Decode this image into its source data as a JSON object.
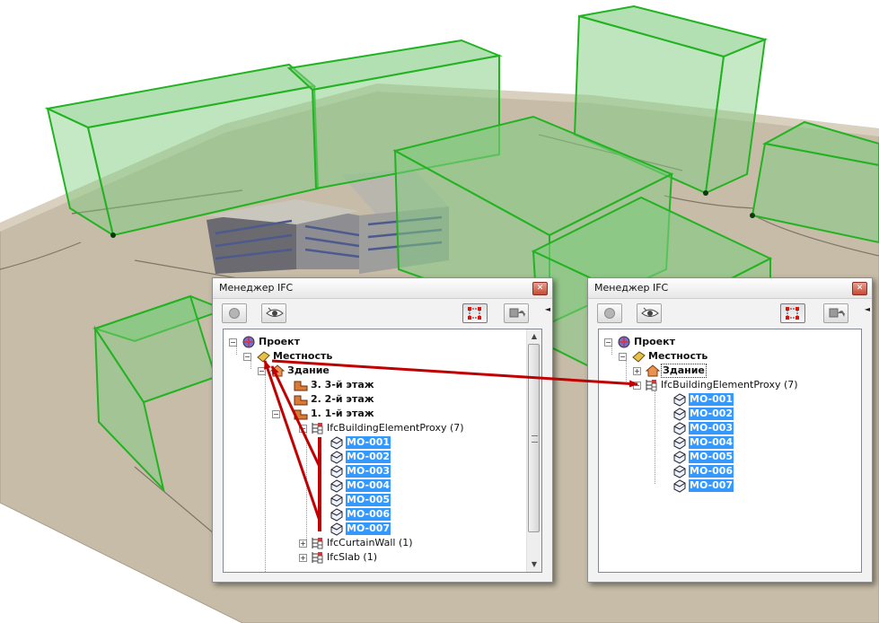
{
  "colors": {
    "bbox_fill": "#7fcc7f",
    "bbox_edge": "#22b322",
    "ground": "#c7bca8",
    "annotation_arrow": "#c00000",
    "selection": "#3399ff"
  },
  "left_window": {
    "title": "Менеджер IFC",
    "tree": {
      "project": "Проект",
      "site": "Местность",
      "building": "Здание",
      "storeys": [
        "3. 3-й этаж",
        "2. 2-й этаж",
        "1. 1-й этаж"
      ],
      "proxy_group": "IfcBuildingElementProxy (7)",
      "proxy_items": [
        "MO-001",
        "MO-002",
        "MO-003",
        "MO-004",
        "MO-005",
        "MO-006",
        "MO-007"
      ],
      "curtain_wall_group": "IfcCurtainWall (1)",
      "slab_group": "IfcSlab (1)"
    }
  },
  "right_window": {
    "title": "Менеджер IFC",
    "tree": {
      "project": "Проект",
      "site": "Местность",
      "building": "Здание",
      "proxy_group": "IfcBuildingElementProxy (7)",
      "proxy_items": [
        "MO-001",
        "MO-002",
        "MO-003",
        "MO-004",
        "MO-005",
        "MO-006",
        "MO-007"
      ]
    }
  },
  "icons": {
    "close": "close-icon",
    "circle_button": "circle-icon",
    "eye_button": "eye-icon",
    "select_frame": "selection-frame-icon",
    "move_to": "move-element-icon",
    "project": "project-icon",
    "site": "site-icon",
    "building": "building-icon",
    "storey": "storey-icon",
    "group": "ifc-group-icon",
    "element": "proxy-element-icon"
  }
}
